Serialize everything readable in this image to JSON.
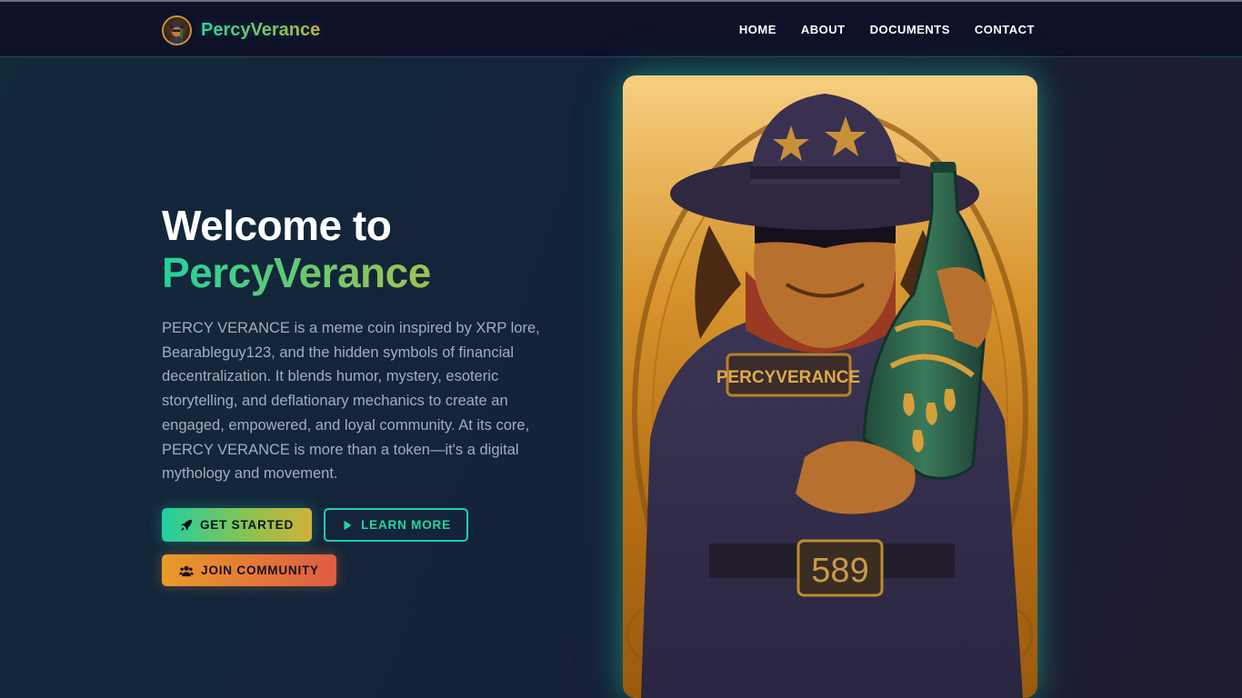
{
  "nav": {
    "brand": "PercyVerance",
    "links": [
      "HOME",
      "ABOUT",
      "DOCUMENTS",
      "CONTACT"
    ]
  },
  "hero": {
    "title_line1": "Welcome to",
    "title_line2": "PercyVerance",
    "description": "PERCY VERANCE is a meme coin inspired by XRP lore, Bearableguy123, and the hidden symbols of financial decentralization. It blends humor, mystery, esoteric storytelling, and deflationary mechanics to create an engaged, empowered, and loyal community. At its core, PERCY VERANCE is more than a token—it's a digital mythology and movement.",
    "buttons": {
      "get_started": "GET STARTED",
      "learn_more": "LEARN MORE",
      "join_community": "JOIN COMMUNITY"
    },
    "image": {
      "chest_patch": "PERCYVERANCE",
      "belt_number": "589"
    }
  },
  "colors": {
    "accent_teal": "#1fd0a0",
    "accent_gold": "#d1b03a",
    "accent_orange": "#e3743a",
    "nav_bg": "#0f1128"
  },
  "icons": {
    "get_started": "rocket-icon",
    "learn_more": "play-icon",
    "join_community": "users-icon"
  }
}
